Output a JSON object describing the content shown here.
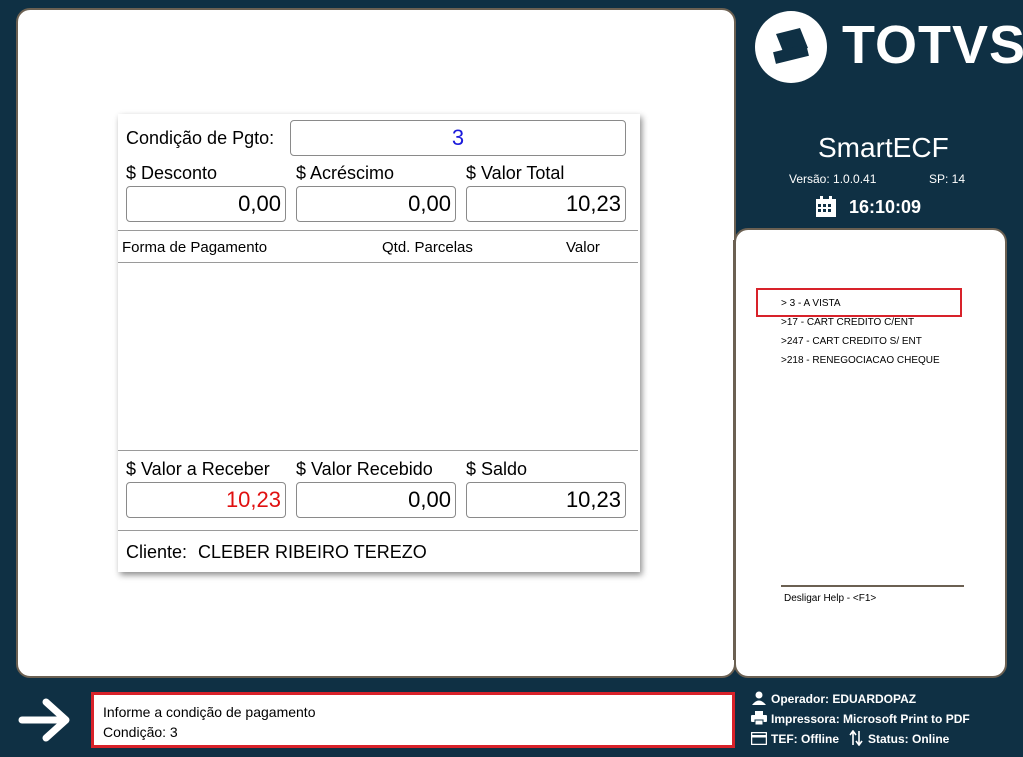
{
  "brand": {
    "logo_text": "TOTVS",
    "app_name": "SmartECF",
    "version": "Versão: 1.0.0.41",
    "sp": "SP: 14",
    "clock": "16:10:09"
  },
  "payment": {
    "condition_label": "Condição de Pgto:",
    "condition_value": "3",
    "discount_label": "$ Desconto",
    "discount_value": "0,00",
    "surcharge_label": "$ Acréscimo",
    "surcharge_value": "0,00",
    "total_label": "$ Valor Total",
    "total_value": "10,23",
    "columns": [
      "Forma de Pagamento",
      "Qtd. Parcelas",
      "Valor"
    ],
    "rows": [],
    "receive_label": "$ Valor a Receber",
    "receive_value": "10,23",
    "received_label": "$ Valor Recebido",
    "received_value": "0,00",
    "balance_label": "$ Saldo",
    "balance_value": "10,23",
    "client_label": "Cliente:",
    "client_name": "CLEBER RIBEIRO TEREZO"
  },
  "help": {
    "items": [
      ">  3 - A VISTA",
      ">17 - CART CREDITO C/ENT",
      ">247 - CART CREDITO S/ ENT",
      ">218 - RENEGOCIACAO CHEQUE"
    ],
    "footer": "Desligar Help - <F1>"
  },
  "message": {
    "line1": "Informe a condição de pagamento",
    "line2": "Condição:  3"
  },
  "status": {
    "operator": "Operador: EDUARDOPAZ",
    "printer": "Impressora: Microsoft Print to PDF",
    "tef": "TEF: Offline",
    "status": "Status:  Online"
  },
  "colors": {
    "background": "#0f3044",
    "highlight": "#d8222a",
    "condition": "#1a1adb",
    "receive": "#e01010"
  }
}
